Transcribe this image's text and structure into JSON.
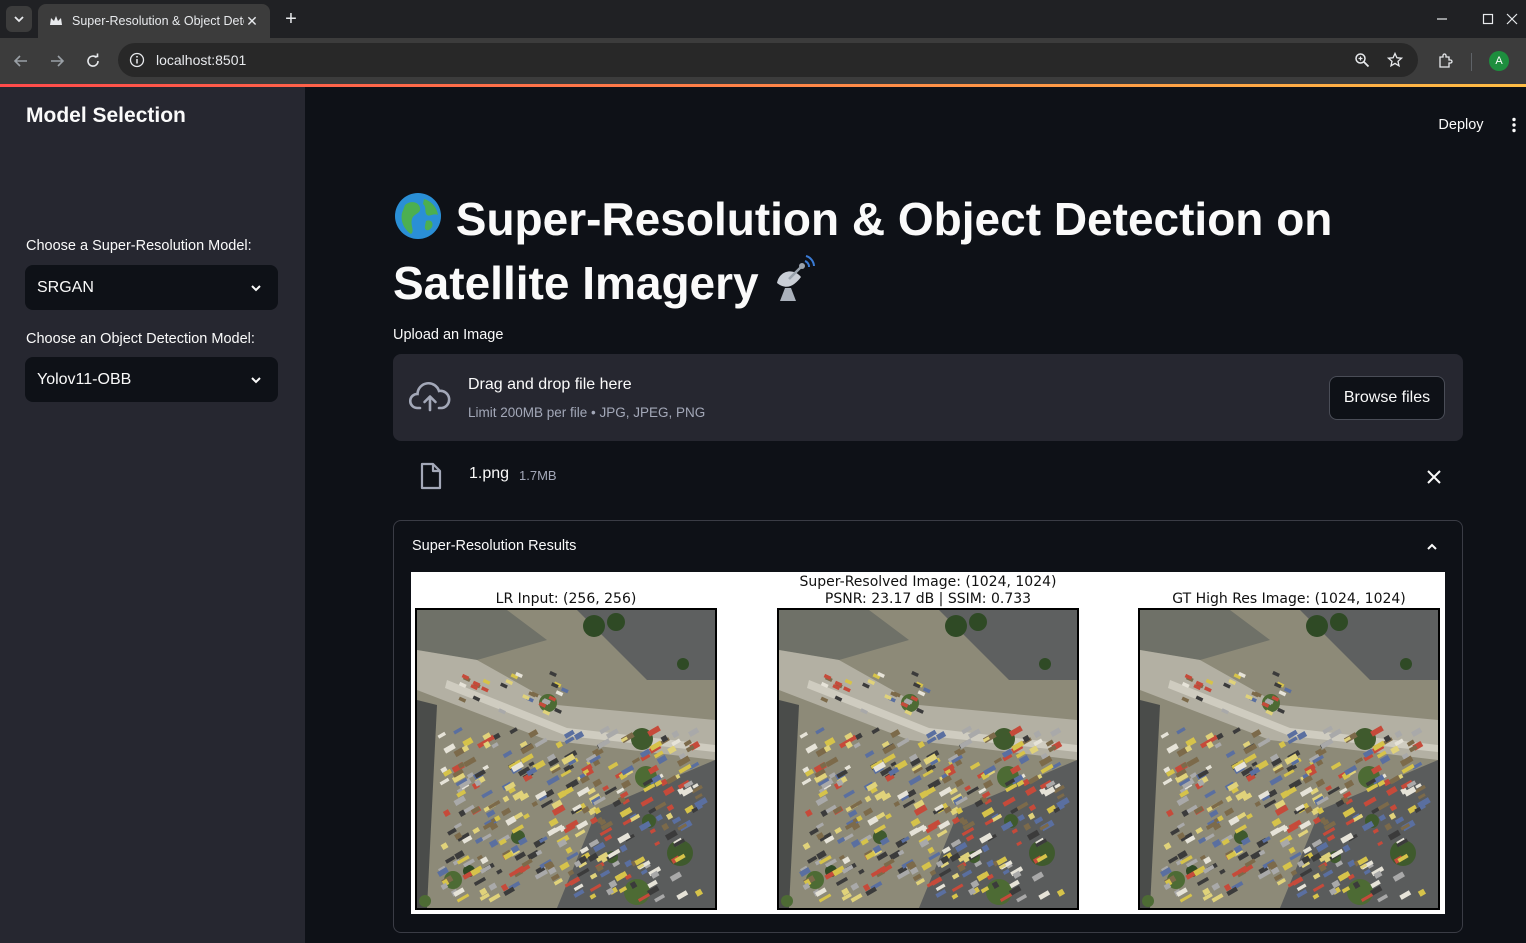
{
  "browser": {
    "tab_title": "Super-Resolution & Object Detection",
    "url": "localhost:8501",
    "profile_initial": "A"
  },
  "header": {
    "deploy_label": "Deploy"
  },
  "sidebar": {
    "title": "Model Selection",
    "sr_label": "Choose a Super-Resolution Model:",
    "sr_value": "SRGAN",
    "od_label": "Choose an Object Detection Model:",
    "od_value": "Yolov11-OBB"
  },
  "main": {
    "title_line1": "Super-Resolution & Object Detection on",
    "title_line2": "Satellite Imagery",
    "title_emoji_1": "🌍",
    "title_emoji_2": "📡",
    "upload_label": "Upload an Image",
    "dropzone_main": "Drag and drop file here",
    "dropzone_sub": "Limit 200MB per file • JPG, JPEG, PNG",
    "browse_label": "Browse files",
    "file_name": "1.png",
    "file_size": "1.7MB"
  },
  "results": {
    "title": "Super-Resolution Results",
    "panels": [
      {
        "caption_lines": [
          "LR Input: (256, 256)"
        ]
      },
      {
        "caption_lines": [
          "Super-Resolved Image: (1024, 1024)",
          "PSNR: 23.17 dB | SSIM: 0.733"
        ]
      },
      {
        "caption_lines": [
          "GT High Res Image: (1024, 1024)"
        ]
      }
    ]
  },
  "icons": {
    "tab_menu": "chevron-down-icon",
    "favicon": "streamlit-crown-icon",
    "back": "arrow-left-icon",
    "forward": "arrow-right-icon",
    "reload": "reload-icon",
    "info": "info-icon",
    "zoom": "zoom-icon",
    "star": "star-icon",
    "extensions": "puzzle-icon",
    "upload": "cloud-upload-icon",
    "file": "file-icon",
    "remove": "close-icon",
    "collapse": "chevron-up-icon"
  },
  "colors": {
    "background": "#0e1117",
    "sidebar": "#262730",
    "accent_start": "#ff4b4b",
    "accent_end": "#ffbd45"
  }
}
